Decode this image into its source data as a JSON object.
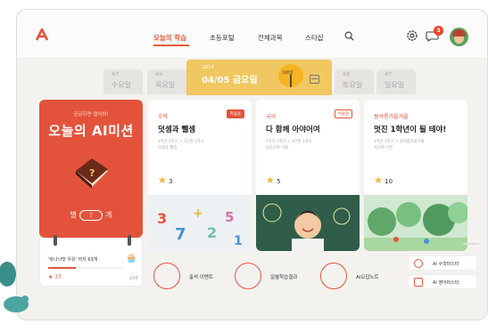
{
  "header": {
    "nav": [
      {
        "label": "오늘의 학습"
      },
      {
        "label": "초등포털"
      },
      {
        "label": "전체과목"
      },
      {
        "label": "스타샵"
      }
    ],
    "notification_count": "3"
  },
  "datebar": {
    "days": [
      {
        "date": "4/3",
        "weekday": "수요일"
      },
      {
        "date": "4/4",
        "weekday": "목요일"
      },
      {
        "date": "4/6",
        "weekday": "토요일"
      },
      {
        "date": "4/7",
        "weekday": "일요일"
      }
    ],
    "today": {
      "year": "2019",
      "date": "04/05 금요일",
      "tag": "식목일"
    }
  },
  "mission": {
    "subtitle": "궁금하면 열어봐!",
    "title": "오늘의 AI미션",
    "stars_prefix": "별",
    "stars_value": "?",
    "stars_suffix": "개"
  },
  "progress": {
    "label": "'바나나맛 우유' 까지 63개",
    "current": "37",
    "max": "100",
    "fraction": 0.37
  },
  "cards": [
    {
      "category": "수학",
      "tag": "학습용",
      "title": "덧셈과 뺄셈",
      "desc1": "1학년 1학기 > 3단원 1차시",
      "desc2": "덧셈과 뺄셈",
      "count": "3"
    },
    {
      "category": "국어",
      "tag": "서술형",
      "title": "다 함께 아야어여",
      "desc1": "1학년 1학기 > 3단원 1차시",
      "desc2": "모음자와 이름",
      "count": "5"
    },
    {
      "category": "봄여름가을겨울",
      "tag": "",
      "title": "멋진 1학년이 될 테야!",
      "desc1": "1학년 1학기 > 봄여름가을겨울",
      "desc2": "학교에 가면",
      "count": "10"
    }
  ],
  "bottom_menu": [
    {
      "label": "출석 이벤트"
    },
    {
      "label": "일별학습결과"
    },
    {
      "label": "AI오답노트"
    }
  ],
  "ai_buttons": [
    {
      "label": "AI 수학마스터"
    },
    {
      "label": "AI 영어마스터"
    }
  ],
  "colors": {
    "accent": "#e3533b",
    "today": "#f0c760",
    "star": "#f0b83a"
  }
}
